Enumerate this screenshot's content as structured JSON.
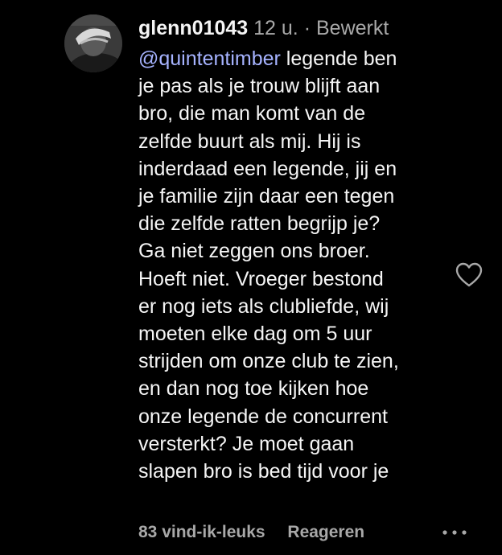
{
  "comment": {
    "username": "glenn01043",
    "time": "12 u.",
    "separator": "·",
    "edited": "Bewerkt",
    "mention": "@quintentimber",
    "lines": [
      " legende ben",
      "je pas als je trouw blijft aan",
      "bro, die man komt van de",
      "zelfde buurt als mij. Hij is",
      "inderdaad een legende, jij en",
      "je familie zijn daar een tegen",
      "die zelfde ratten begrijp je?",
      "Ga niet zeggen ons broer.",
      "Hoeft niet. Vroeger bestond",
      "er nog iets als clubliefde, wij",
      "moeten elke dag om 5 uur",
      "strijden om onze club te zien,",
      "en dan nog toe kijken hoe",
      "onze legende de concurrent",
      "versterkt? Je moet gaan",
      "slapen bro is bed tijd voor je"
    ],
    "likes": "83 vind-ik-leuks",
    "reply": "Reageren"
  },
  "icons": {
    "like": "heart-icon",
    "more": "more-options-icon"
  },
  "colors": {
    "background": "#000000",
    "text": "#f5f5f5",
    "secondary": "#a8a8a8",
    "mention": "#a6b3ff"
  }
}
